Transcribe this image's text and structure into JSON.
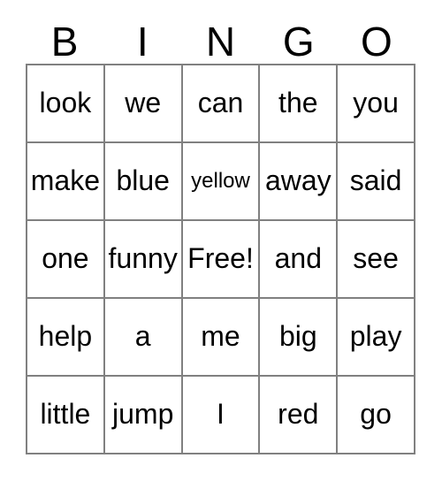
{
  "card": {
    "title_letters": [
      "B",
      "I",
      "N",
      "G",
      "O"
    ],
    "free_space_label": "Free!",
    "grid": {
      "rows": 5,
      "columns": 5,
      "border_color": "#808080",
      "background_color": "#ffffff",
      "text_color": "#000000"
    },
    "cells": [
      [
        {
          "text": "look",
          "size": "normal"
        },
        {
          "text": "we",
          "size": "normal"
        },
        {
          "text": "can",
          "size": "normal"
        },
        {
          "text": "the",
          "size": "normal"
        },
        {
          "text": "you",
          "size": "normal"
        }
      ],
      [
        {
          "text": "make",
          "size": "normal"
        },
        {
          "text": "blue",
          "size": "normal"
        },
        {
          "text": "yellow",
          "size": "small"
        },
        {
          "text": "away",
          "size": "normal"
        },
        {
          "text": "said",
          "size": "normal"
        }
      ],
      [
        {
          "text": "one",
          "size": "normal"
        },
        {
          "text": "funny",
          "size": "normal"
        },
        {
          "text": "Free!",
          "size": "normal"
        },
        {
          "text": "and",
          "size": "normal"
        },
        {
          "text": "see",
          "size": "normal"
        }
      ],
      [
        {
          "text": "help",
          "size": "normal"
        },
        {
          "text": "a",
          "size": "normal"
        },
        {
          "text": "me",
          "size": "normal"
        },
        {
          "text": "big",
          "size": "normal"
        },
        {
          "text": "play",
          "size": "normal"
        }
      ],
      [
        {
          "text": "little",
          "size": "normal"
        },
        {
          "text": "jump",
          "size": "normal"
        },
        {
          "text": "I",
          "size": "normal"
        },
        {
          "text": "red",
          "size": "normal"
        },
        {
          "text": "go",
          "size": "normal"
        }
      ]
    ]
  }
}
